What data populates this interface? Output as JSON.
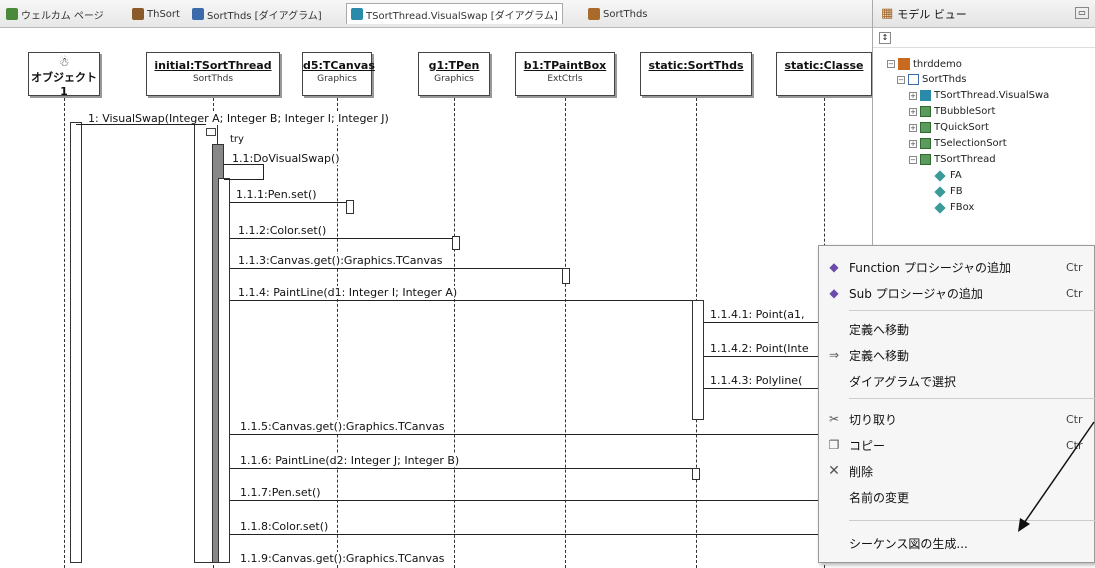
{
  "tabs": [
    {
      "label": "ウェルカム ページ",
      "icon": "welcome-page-icon",
      "color": "#4a8a3a"
    },
    {
      "label": "ThSort",
      "icon": "class-icon",
      "color": "#8a5a2a"
    },
    {
      "label": "SortThds [ダイアグラム]",
      "icon": "diagram-icon",
      "color": "#3a6aaa"
    },
    {
      "label": "TSortThread.VisualSwap [ダイアグラム]",
      "icon": "sequence-diagram-icon",
      "color": "#2a8aaa"
    },
    {
      "label": "SortThds",
      "icon": "unit-icon",
      "color": "#aa6a2a"
    }
  ],
  "model_view": {
    "title": "モデル ビュー",
    "tree": [
      {
        "label": "thrddemo",
        "level": 0,
        "icon": "project-icon"
      },
      {
        "label": "SortThds",
        "level": 1,
        "icon": "namespace-icon"
      },
      {
        "label": "TSortThread.VisualSwa",
        "level": 2,
        "icon": "diagram-icon"
      },
      {
        "label": "TBubbleSort",
        "level": 2,
        "icon": "class-icon"
      },
      {
        "label": "TQuickSort",
        "level": 2,
        "icon": "class-icon"
      },
      {
        "label": "TSelectionSort",
        "level": 2,
        "icon": "class-icon"
      },
      {
        "label": "TSortThread",
        "level": 2,
        "icon": "class-icon"
      },
      {
        "label": "FA",
        "level": 3,
        "icon": "field-icon"
      },
      {
        "label": "FB",
        "level": 3,
        "icon": "field-icon"
      },
      {
        "label": "FBox",
        "level": 3,
        "icon": "field-icon"
      }
    ]
  },
  "diagram": {
    "actor": {
      "label": "オブジェクト1"
    },
    "lifelines": [
      {
        "name": "initial:TSortThread",
        "type": "SortThds"
      },
      {
        "name": "d5:TCanvas",
        "type": "Graphics"
      },
      {
        "name": "g1:TPen",
        "type": "Graphics"
      },
      {
        "name": "b1:TPaintBox",
        "type": "ExtCtrls"
      },
      {
        "name": "static:SortThds",
        "type": ""
      },
      {
        "name": "static:Classe",
        "type": ""
      }
    ],
    "messages": [
      "1: VisualSwap(Integer A; Integer B; Integer I; Integer J)",
      "try",
      "1.1:DoVisualSwap()",
      "1.1.1:Pen.set()",
      "1.1.2:Color.set()",
      "1.1.3:Canvas.get():Graphics.TCanvas",
      "1.1.4: PaintLine(d1: Integer I; Integer A)",
      "1.1.4.1: Point(a1,",
      "1.1.4.2: Point(Inte",
      "1.1.4.3: Polyline(",
      "1.1.5:Canvas.get():Graphics.TCanvas",
      "1.1.6: PaintLine(d2: Integer J; Integer B)",
      "1.1.7:Pen.set()",
      "1.1.8:Color.set()",
      "1.1.9:Canvas.get():Graphics.TCanvas"
    ]
  },
  "context_menu": {
    "items": [
      {
        "label": "Function プロシージャの追加",
        "shortcut": "Ctr",
        "icon": "add-function-icon"
      },
      {
        "label": "Sub プロシージャの追加",
        "shortcut": "Ctr",
        "icon": "add-sub-icon"
      },
      {
        "label": "定義へ移動",
        "shortcut": "",
        "icon": ""
      },
      {
        "label": "定義へ移動",
        "shortcut": "",
        "icon": "goto-definition-icon"
      },
      {
        "label": "ダイアグラムで選択",
        "shortcut": "",
        "icon": ""
      },
      {
        "label": "切り取り",
        "shortcut": "Ctr",
        "icon": "cut-icon"
      },
      {
        "label": "コピー",
        "shortcut": "Ctr",
        "icon": "copy-icon"
      },
      {
        "label": "削除",
        "shortcut": "",
        "icon": "delete-icon"
      },
      {
        "label": "名前の変更",
        "shortcut": "",
        "icon": ""
      },
      {
        "label": "シーケンス図の生成...",
        "shortcut": "",
        "icon": ""
      }
    ]
  }
}
